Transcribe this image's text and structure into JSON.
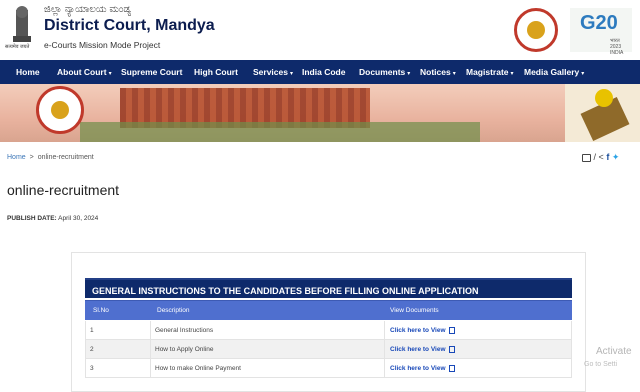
{
  "header": {
    "emblem_caption": "सत्यमेव जयते",
    "title_kannada": "ಜಿಲ್ಲಾ ನ್ಯಾಯಾಲಯ ಮಂಡ್ಯ",
    "title": "District Court, Mandya",
    "subtitle": "e-Courts Mission Mode Project",
    "g20_text": "G20",
    "g20_sub": "भारत 2023 INDIA"
  },
  "nav": {
    "items": [
      {
        "label": "Home",
        "dropdown": false
      },
      {
        "label": "About Court",
        "dropdown": true
      },
      {
        "label": "Supreme Court",
        "dropdown": false
      },
      {
        "label": "High Court",
        "dropdown": false
      },
      {
        "label": "Services",
        "dropdown": true
      },
      {
        "label": "India Code",
        "dropdown": false
      },
      {
        "label": "Documents",
        "dropdown": true
      },
      {
        "label": "Notices",
        "dropdown": true
      },
      {
        "label": "Magistrate",
        "dropdown": true
      },
      {
        "label": "Media Gallery",
        "dropdown": true
      }
    ],
    "caret": "▾"
  },
  "breadcrumb": {
    "home": "Home",
    "separator": ">",
    "current": "online-recruitment"
  },
  "page": {
    "title": "online-recruitment",
    "publish_label": "PUBLISH DATE:",
    "publish_date": "April 30, 2024"
  },
  "table": {
    "heading": "GENERAL INSTRUCTIONS TO THE CANDIDATES BEFORE FILLING ONLINE APPLICATION",
    "columns": [
      "Sl.No",
      "Description",
      "View Documents"
    ],
    "rows": [
      {
        "no": "1",
        "description": "General Instructions",
        "link": "Click here to View"
      },
      {
        "no": "2",
        "description": "How to Apply Online",
        "link": "Click here to View"
      },
      {
        "no": "3",
        "description": "How to make Online Payment",
        "link": "Click here to View"
      }
    ]
  },
  "overlay": {
    "activate": "Activate",
    "activate_sub": "Go to Setti"
  },
  "colors": {
    "nav_bg": "#0e2a6b",
    "table_head_bg": "#0e2a6b",
    "column_head_bg": "#4f6fcf",
    "link": "#1848b8"
  }
}
